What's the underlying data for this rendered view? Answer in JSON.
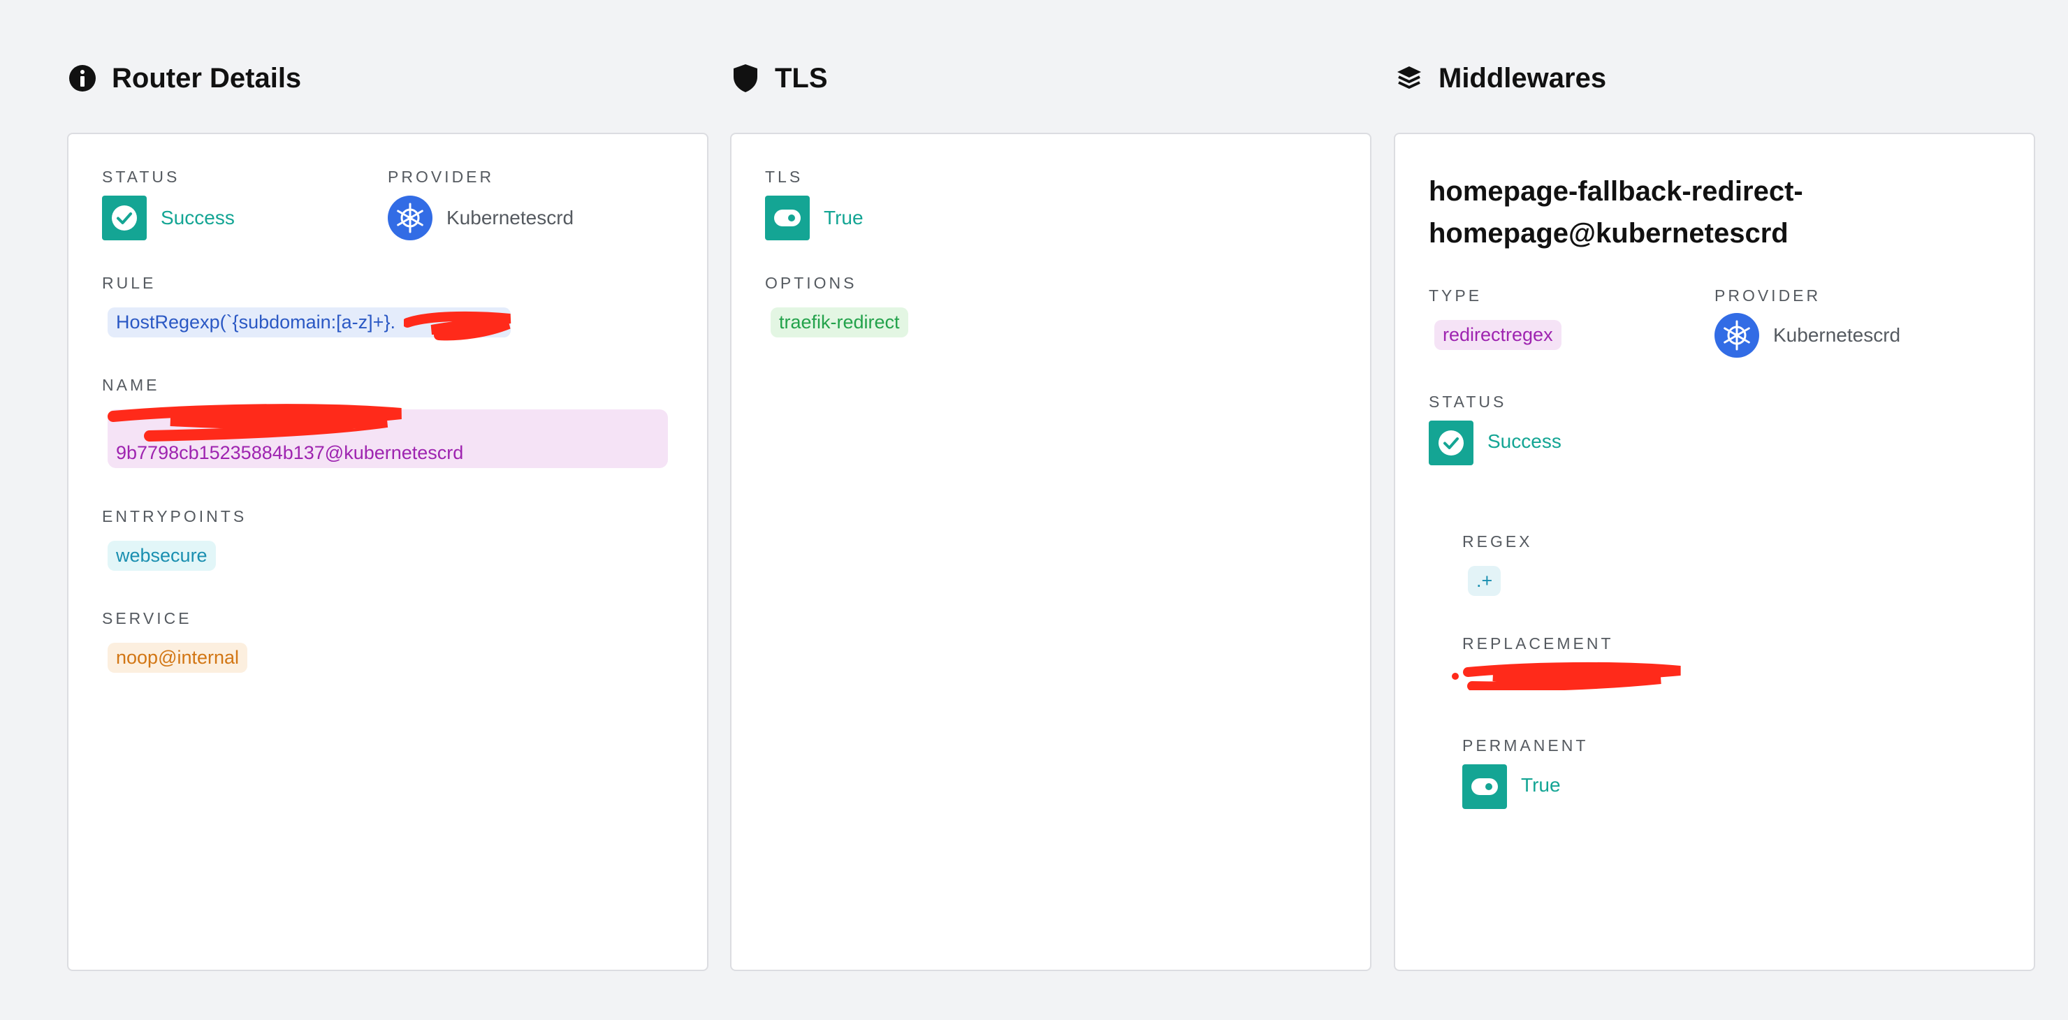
{
  "router_details": {
    "title": "Router Details",
    "status_label": "STATUS",
    "status_value": "Success",
    "provider_label": "PROVIDER",
    "provider_value": "Kubernetescrd",
    "rule_label": "RULE",
    "rule_value": "HostRegexp(`{subdomain:[a-z]+}.",
    "rule_suffix": "`)",
    "name_label": "NAME",
    "name_line2": "9b7798cb15235884b137@kubernetescrd",
    "entrypoints_label": "ENTRYPOINTS",
    "entrypoints": [
      "websecure"
    ],
    "service_label": "SERVICE",
    "service_value": "noop@internal"
  },
  "tls": {
    "title": "TLS",
    "tls_label": "TLS",
    "tls_value": "True",
    "options_label": "OPTIONS",
    "options_value": "traefik-redirect"
  },
  "middlewares": {
    "title": "Middlewares",
    "name_line1": "homepage-fallback-redirect-",
    "name_line2": "homepage@kubernetescrd",
    "type_label": "TYPE",
    "type_value": "redirectregex",
    "provider_label": "PROVIDER",
    "provider_value": "Kubernetescrd",
    "status_label": "STATUS",
    "status_value": "Success",
    "regex_label": "REGEX",
    "regex_value": ".+",
    "replacement_label": "REPLACEMENT",
    "permanent_label": "PERMANENT",
    "permanent_value": "True"
  },
  "colors": {
    "success": "#14a594",
    "kubernetes": "#326ce5",
    "redaction": "#ff2a1a"
  },
  "icons": {
    "router_details": "info-icon",
    "tls": "shield-icon",
    "middlewares": "layers-icon",
    "status": "check-circle-icon",
    "toggle": "toggle-icon",
    "provider": "kubernetes-icon"
  }
}
